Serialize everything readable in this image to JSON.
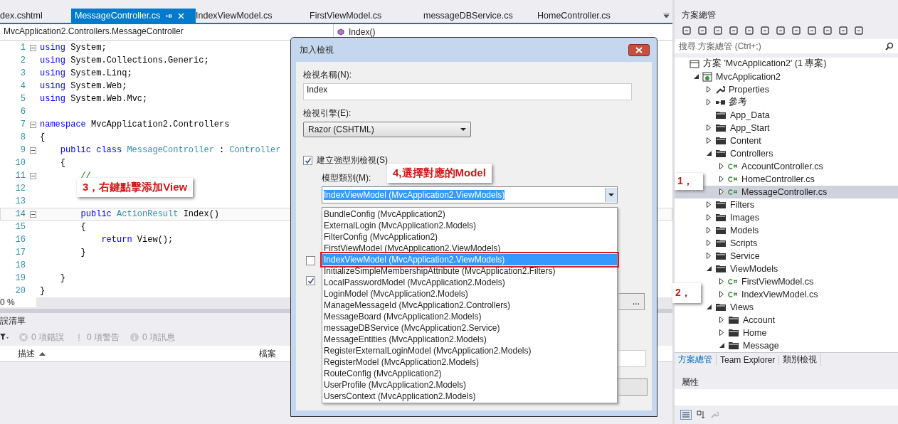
{
  "editor": {
    "tabs": [
      {
        "label": "dex.cshtml",
        "selected": false
      },
      {
        "label": "MessageController.cs",
        "selected": true
      },
      {
        "label": "IndexViewModel.cs",
        "selected": false
      },
      {
        "label": "FirstViewModel.cs",
        "selected": false
      },
      {
        "label": "messageDBService.cs",
        "selected": false
      },
      {
        "label": "HomeController.cs",
        "selected": false
      }
    ],
    "nav_class": "MvcApplication2.Controllers.MessageController",
    "nav_member": "Index()",
    "lines": [
      {
        "number": "1",
        "fold": true,
        "current": false,
        "segments": [
          {
            "kind": "kw",
            "text": "using"
          },
          {
            "kind": "plain",
            "text": " System;"
          }
        ]
      },
      {
        "number": "2",
        "fold": false,
        "current": false,
        "segments": [
          {
            "kind": "kw",
            "text": "using"
          },
          {
            "kind": "plain",
            "text": " System.Collections.Generic;"
          }
        ]
      },
      {
        "number": "3",
        "fold": false,
        "current": false,
        "segments": [
          {
            "kind": "kw",
            "text": "using"
          },
          {
            "kind": "plain",
            "text": " System.Linq;"
          }
        ]
      },
      {
        "number": "4",
        "fold": false,
        "current": false,
        "segments": [
          {
            "kind": "kw",
            "text": "using"
          },
          {
            "kind": "plain",
            "text": " System.Web;"
          }
        ]
      },
      {
        "number": "5",
        "fold": false,
        "current": false,
        "segments": [
          {
            "kind": "kw",
            "text": "using"
          },
          {
            "kind": "plain",
            "text": " System.Web.Mvc;"
          }
        ]
      },
      {
        "number": "6",
        "fold": false,
        "current": false
      },
      {
        "number": "7",
        "fold": true,
        "current": false,
        "segments": [
          {
            "kind": "kw",
            "text": "namespace"
          },
          {
            "kind": "plain",
            "text": " MvcApplication2.Controllers"
          }
        ]
      },
      {
        "number": "8",
        "fold": false,
        "current": false,
        "segments": [
          {
            "kind": "plain",
            "text": "{"
          }
        ]
      },
      {
        "number": "9",
        "fold": true,
        "current": false,
        "segments": [
          {
            "kind": "kw",
            "text": "    public class"
          },
          {
            "kind": "type",
            "text": " MessageController"
          },
          {
            "kind": "plain",
            "text": " : "
          },
          {
            "kind": "type",
            "text": "Controller"
          }
        ]
      },
      {
        "number": "10",
        "fold": false,
        "current": false,
        "segments": [
          {
            "kind": "plain",
            "text": "    {"
          }
        ]
      },
      {
        "number": "11",
        "fold": true,
        "current": false,
        "segments": [
          {
            "kind": "comment",
            "text": "        //"
          }
        ]
      },
      {
        "number": "12",
        "fold": false,
        "current": false
      },
      {
        "number": "13",
        "fold": false,
        "current": false
      },
      {
        "number": "14",
        "fold": true,
        "current": true,
        "segments": [
          {
            "kind": "kw",
            "text": "        public"
          },
          {
            "kind": "type",
            "text": " ActionResult"
          },
          {
            "kind": "plain",
            "text": " Index()"
          }
        ]
      },
      {
        "number": "15",
        "fold": false,
        "current": false,
        "segments": [
          {
            "kind": "plain",
            "text": "        {"
          }
        ]
      },
      {
        "number": "16",
        "fold": false,
        "current": false,
        "segments": [
          {
            "kind": "kw",
            "text": "            return"
          },
          {
            "kind": "plain",
            "text": " View();"
          }
        ]
      },
      {
        "number": "17",
        "fold": false,
        "current": false,
        "segments": [
          {
            "kind": "plain",
            "text": "        }"
          }
        ]
      },
      {
        "number": "18",
        "fold": false,
        "current": false
      },
      {
        "number": "19",
        "fold": false,
        "current": false,
        "segments": [
          {
            "kind": "plain",
            "text": "    }"
          }
        ]
      },
      {
        "number": "20",
        "fold": false,
        "current": false,
        "segments": [
          {
            "kind": "plain",
            "text": "}"
          }
        ]
      }
    ],
    "zoom": "0 %"
  },
  "error_list": {
    "title": "誤清單",
    "counts": [
      "0 項錯誤",
      "0 項警告",
      "0 項訊息"
    ],
    "columns": [
      "描述",
      "檔案"
    ]
  },
  "dialog": {
    "title": "加入檢視",
    "name_label": "檢視名稱(N):",
    "name_value": "Index",
    "engine_label": "檢視引擎(E):",
    "engine_value": "Razor (CSHTML)",
    "strong_typed": {
      "label": "建立強型別檢視(S)",
      "checked": true
    },
    "model_label": "模型類別(M):",
    "model_value": "IndexViewModel (MvcApplication2.ViewModels)",
    "model_options": [
      {
        "label": "BundleConfig (MvcApplication2)",
        "selected": false
      },
      {
        "label": "ExternalLogin (MvcApplication2.Models)",
        "selected": false
      },
      {
        "label": "FilterConfig (MvcApplication2)",
        "selected": false
      },
      {
        "label": "FirstViewModel (MvcApplication2.ViewModels)",
        "selected": false
      },
      {
        "label": "IndexViewModel (MvcApplication2.ViewModels)",
        "selected": true
      },
      {
        "label": "InitializeSimpleMembershipAttribute (MvcApplication2.Filters)",
        "selected": false
      },
      {
        "label": "LocalPasswordModel (MvcApplication2.Models)",
        "selected": false
      },
      {
        "label": "LoginModel (MvcApplication2.Models)",
        "selected": false
      },
      {
        "label": "ManageMessageId (MvcApplication2.Controllers)",
        "selected": false
      },
      {
        "label": "MessageBoard (MvcApplication2.Models)",
        "selected": false
      },
      {
        "label": "messageDBService (MvcApplication2.Service)",
        "selected": false
      },
      {
        "label": "MessageEntities (MvcApplication2.Models)",
        "selected": false
      },
      {
        "label": "RegisterExternalLoginModel (MvcApplication2.Models)",
        "selected": false
      },
      {
        "label": "RegisterModel (MvcApplication2.Models)",
        "selected": false
      },
      {
        "label": "RouteConfig (MvcApplication2)",
        "selected": false
      },
      {
        "label": "UserProfile (MvcApplication2.Models)",
        "selected": false
      },
      {
        "label": "UsersContext (MvcApplication2.Models)",
        "selected": false
      }
    ],
    "hidden_options": [
      {
        "checked": false
      },
      {
        "checked": true
      }
    ],
    "browse_button": "..."
  },
  "explorer": {
    "title": "方案總管",
    "search": {
      "placeholder": "搜尋 方案總管 (Ctrl+;)"
    },
    "tree": [
      {
        "label": "方案 'MvcApplication2' (1 專案)",
        "kind": "solution",
        "selected": false,
        "children": [
          {
            "label": "MvcApplication2",
            "kind": "project",
            "expanded": true,
            "selected": false,
            "children": [
              {
                "label": "Properties",
                "kind": "properties",
                "expanded": false,
                "selected": false
              },
              {
                "label": "參考",
                "kind": "references",
                "expanded": false,
                "selected": false
              },
              {
                "label": "App_Data",
                "kind": "folder",
                "selected": false
              },
              {
                "label": "App_Start",
                "kind": "folder",
                "expanded": false,
                "selected": false
              },
              {
                "label": "Content",
                "kind": "folder",
                "expanded": false,
                "selected": false
              },
              {
                "label": "Controllers",
                "kind": "folder",
                "expanded": true,
                "selected": false,
                "children": [
                  {
                    "label": "AccountController.cs",
                    "kind": "cs",
                    "expanded": false,
                    "selected": false
                  },
                  {
                    "label": "HomeController.cs",
                    "kind": "cs",
                    "expanded": false,
                    "selected": false
                  },
                  {
                    "label": "MessageController.cs",
                    "kind": "cs",
                    "expanded": false,
                    "selected": true
                  }
                ]
              },
              {
                "label": "Filters",
                "kind": "folder",
                "expanded": false,
                "selected": false
              },
              {
                "label": "Images",
                "kind": "folder",
                "expanded": false,
                "selected": false
              },
              {
                "label": "Models",
                "kind": "folder",
                "expanded": false,
                "selected": false
              },
              {
                "label": "Scripts",
                "kind": "folder",
                "expanded": false,
                "selected": false
              },
              {
                "label": "Service",
                "kind": "folder",
                "expanded": false,
                "selected": false
              },
              {
                "label": "ViewModels",
                "kind": "folder",
                "expanded": true,
                "selected": false,
                "children": [
                  {
                    "label": "FirstViewModel.cs",
                    "kind": "cs",
                    "expanded": false,
                    "selected": false
                  },
                  {
                    "label": "IndexViewModel.cs",
                    "kind": "cs",
                    "expanded": false,
                    "selected": false
                  }
                ]
              },
              {
                "label": "Views",
                "kind": "folder",
                "expanded": true,
                "selected": false,
                "children": [
                  {
                    "label": "Account",
                    "kind": "folder",
                    "expanded": false,
                    "selected": false
                  },
                  {
                    "label": "Home",
                    "kind": "folder",
                    "expanded": false,
                    "selected": false
                  },
                  {
                    "label": "Message",
                    "kind": "folder",
                    "expanded": true,
                    "selected": false
                  }
                ]
              }
            ]
          }
        ]
      }
    ],
    "tabs": [
      {
        "label": "方案總管",
        "selected": true
      },
      {
        "label": "Team Explorer",
        "selected": false
      },
      {
        "label": "類別檢視",
        "selected": false
      }
    ],
    "properties_title": "屬性"
  },
  "callouts": [
    "1，",
    "2，",
    "3，右鍵點擊添加View",
    "4,選擇對應的Model"
  ]
}
